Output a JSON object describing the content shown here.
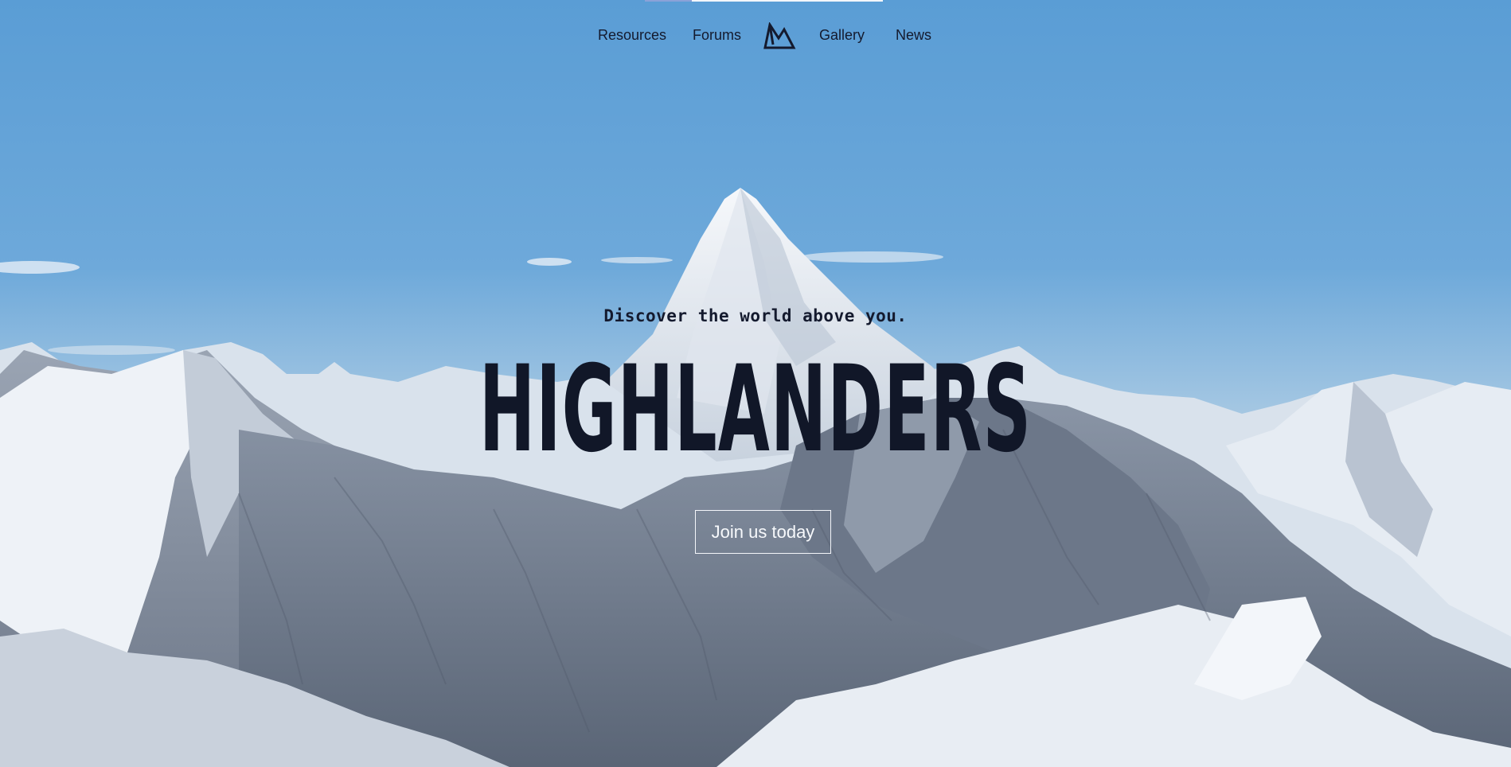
{
  "nav": {
    "items": [
      {
        "label": "Resources"
      },
      {
        "label": "Forums"
      },
      {
        "label": "Gallery"
      },
      {
        "label": "News"
      }
    ],
    "logo_icon": "mountain-logo-icon"
  },
  "hero": {
    "tagline": "Discover the world above you.",
    "title": "HIGHLANDERS",
    "cta_label": "Join us today",
    "background": "snowy-mountain-range-photo"
  },
  "colors": {
    "sky_top": "#5b9ed6",
    "sky_horizon": "#a9cbe6",
    "text_dark": "#111728",
    "button_border": "#f4f6fa"
  }
}
